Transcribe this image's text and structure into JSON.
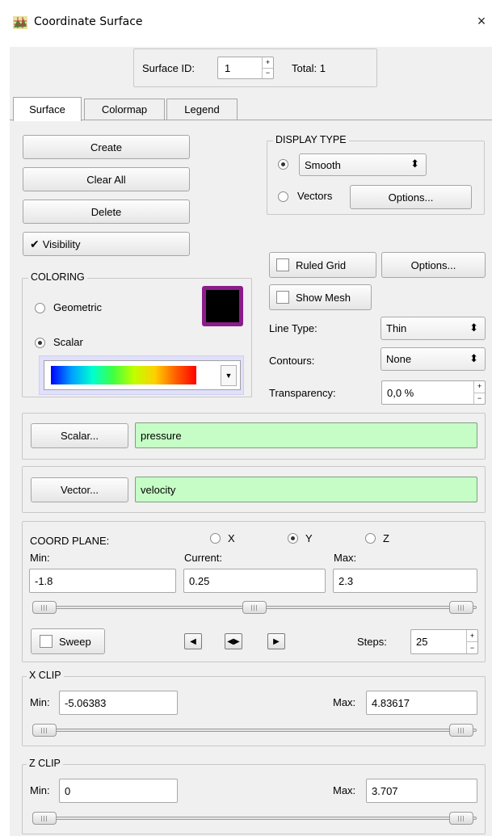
{
  "window": {
    "title": "Coordinate Surface",
    "close_glyph": "×",
    "icon": "surface-app-icon"
  },
  "header": {
    "surface_id_label": "Surface ID:",
    "surface_id_value": "1",
    "total_label": "Total:",
    "total_value": "1"
  },
  "tabs": [
    {
      "label": "Surface",
      "active": true
    },
    {
      "label": "Colormap",
      "active": false
    },
    {
      "label": "Legend",
      "active": false
    }
  ],
  "actions": {
    "create": "Create",
    "clear_all": "Clear All",
    "delete": "Delete",
    "visibility": "Visibility",
    "visibility_checked": true
  },
  "display_type": {
    "legend": "DISPLAY TYPE",
    "smooth_option": "Smooth",
    "smooth_selected": true,
    "vectors_label": "Vectors",
    "options_button": "Options..."
  },
  "coloring": {
    "legend": "COLORING",
    "geometric_label": "Geometric",
    "scalar_label": "Scalar",
    "selected": "Scalar",
    "swatch_color": "#000000",
    "swatch_border_color": "#8b1d8b"
  },
  "grid": {
    "ruled_grid_label": "Ruled Grid",
    "options_button": "Options...",
    "show_mesh_label": "Show Mesh",
    "line_type_label": "Line Type:",
    "line_type_value": "Thin",
    "contours_label": "Contours:",
    "contours_value": "None",
    "transparency_label": "Transparency:",
    "transparency_value": "0,0 %"
  },
  "scalar": {
    "button": "Scalar...",
    "value": "pressure"
  },
  "vector": {
    "button": "Vector...",
    "value": "velocity"
  },
  "coord_plane": {
    "label": "COORD PLANE:",
    "options": [
      "X",
      "Y",
      "Z"
    ],
    "selected": "Y",
    "min_label": "Min:",
    "current_label": "Current:",
    "max_label": "Max:",
    "min_value": "-1.8",
    "current_value": "0.25",
    "max_value": "2.3",
    "sweep_label": "Sweep",
    "steps_label": "Steps:",
    "steps_value": "25"
  },
  "x_clip": {
    "legend": "X CLIP",
    "min_label": "Min:",
    "min_value": "-5.06383",
    "max_label": "Max:",
    "max_value": "4.83617"
  },
  "z_clip": {
    "legend": "Z CLIP",
    "min_label": "Min:",
    "min_value": "0",
    "max_label": "Max:",
    "max_value": "3.707"
  },
  "colors": {
    "accent_green": "#c6fdc6",
    "dialog_bg": "#f0f0f0"
  }
}
